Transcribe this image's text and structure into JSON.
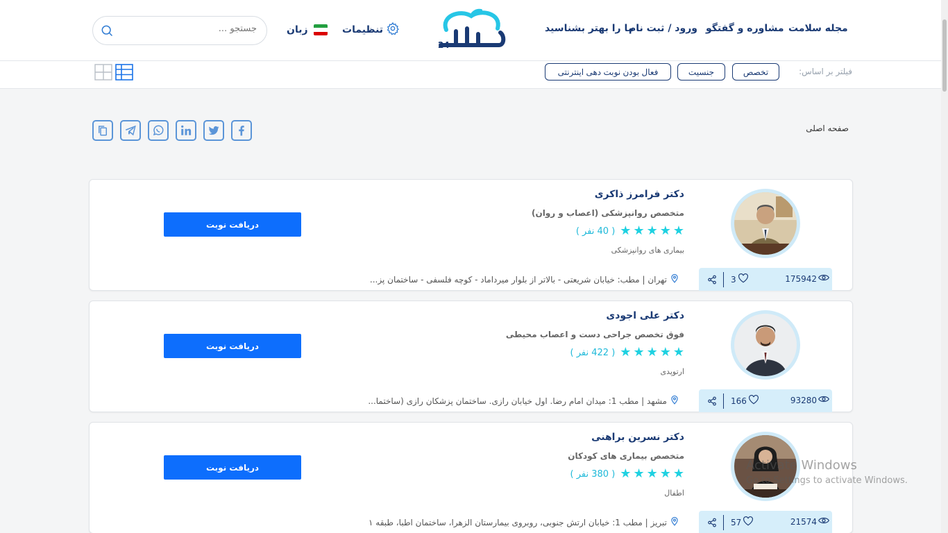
{
  "header": {
    "nav": [
      {
        "label": "مجله سلامت"
      },
      {
        "label": "مشاوره و گفتگو"
      },
      {
        "label": "ورود / ثبت نام"
      },
      {
        "label": "ما را بهتر بشناسید"
      }
    ],
    "logo_text": "سلامتی 24",
    "settings_label": "تنظیمات",
    "language_label": "زبان",
    "search_placeholder": "جستجو ..."
  },
  "filters": {
    "label": "فیلتر بر اساس:",
    "chips": [
      "تخصص",
      "جنسیت",
      "فعال بودن نوبت دهی اینترنتی"
    ]
  },
  "breadcrumb": "صفحه اصلی",
  "share_icons": [
    "copy-icon",
    "telegram-icon",
    "whatsapp-icon",
    "linkedin-icon",
    "twitter-icon",
    "facebook-icon"
  ],
  "doctors": [
    {
      "name": "دکتر فرامرز ذاکری",
      "specialty": "متخصص روانپزشکی (اعصاب و روان)",
      "rating_count": "( 40 نفر )",
      "stars": 5,
      "category": "بیماری های روانپزشکی",
      "address": "تهران | مطب: خیابان شریعتی - بالاتر از بلوار میرداماد - کوچه فلسفی - ساختمان پز...",
      "views": "175942",
      "likes": "3",
      "book_label": "دریافت نوبت"
    },
    {
      "name": "دکتر علی اجودی",
      "specialty": "فوق تخصص جراحی دست و اعصاب محیطی",
      "rating_count": "( 422 نفر )",
      "stars": 5,
      "category": "ارتوپدی",
      "address": "مشهد | مطب 1: میدان امام رضا. اول خیابان رازی. ساختمان پزشکان رازی (ساختما...",
      "views": "93280",
      "likes": "166",
      "book_label": "دریافت نوبت"
    },
    {
      "name": "دکتر نسرین براهنی",
      "specialty": "متخصص بیماری های کودکان",
      "rating_count": "( 380 نفر )",
      "stars": 5,
      "category": "اطفال",
      "address": "تبریز | مطب 1: خیابان ارتش جنوبی، روبروی بیمارستان الزهرا، ساختمان اطبا، طبقه ۱",
      "views": "21574",
      "likes": "57",
      "book_label": "دریافت نوبت"
    }
  ],
  "watermark": {
    "title": "Activate Windows",
    "subtitle": "Go to Settings to activate Windows."
  }
}
